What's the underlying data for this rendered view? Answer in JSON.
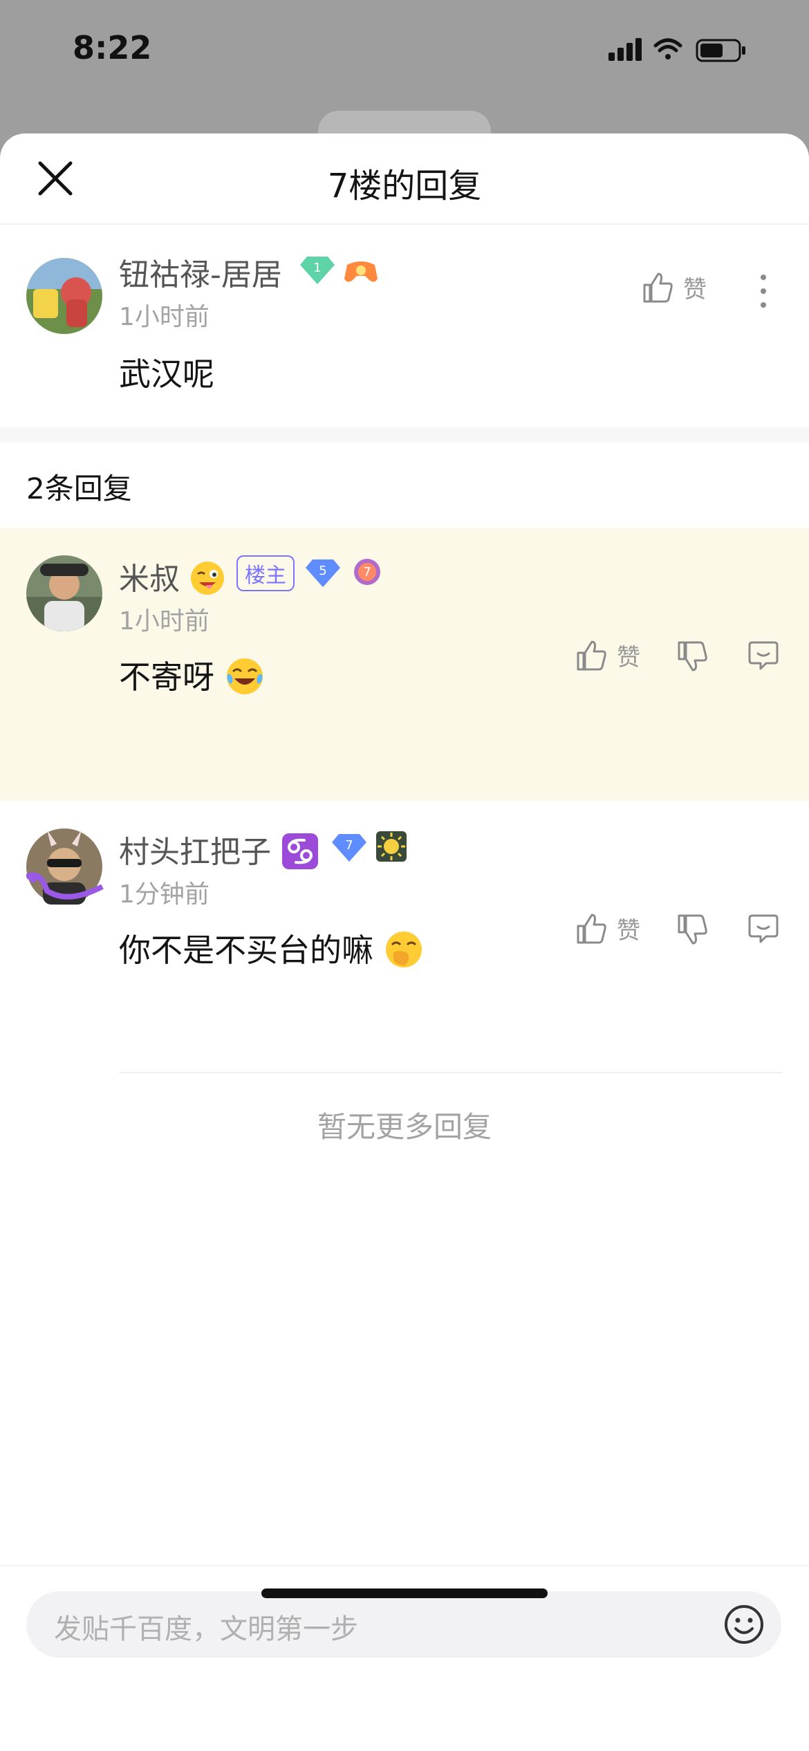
{
  "status_bar": {
    "time": "8:22"
  },
  "sheet": {
    "title": "7楼的回复"
  },
  "main_comment": {
    "username": "钮祜禄-居居",
    "level": "1",
    "time_ago": "1小时前",
    "content": "武汉呢",
    "like_label": "赞"
  },
  "replies_header": {
    "count_label": "2条回复"
  },
  "replies": [
    {
      "username": "米叔",
      "tag": "楼主",
      "level": "5",
      "badge_level": "7",
      "time_ago": "1小时前",
      "content": "不寄呀",
      "like_label": "赞"
    },
    {
      "username": "村头扛把子",
      "level": "7",
      "time_ago": "1分钟前",
      "content": "你不是不买台的嘛",
      "like_label": "赞"
    }
  ],
  "footer_note": "暂无更多回复",
  "input": {
    "placeholder": "发贴千百度，文明第一步"
  },
  "colors": {
    "accent_purple": "#7b74ff",
    "highlight_bg": "#fdf9e9",
    "muted_text": "#a3a3a3"
  }
}
